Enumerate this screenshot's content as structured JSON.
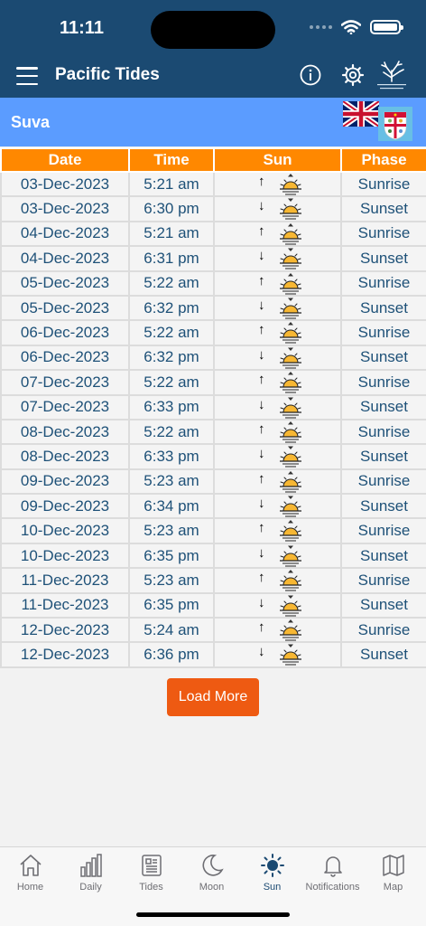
{
  "status": {
    "time": "11:11"
  },
  "header": {
    "title": "Pacific Tides"
  },
  "location": {
    "name": "Suva"
  },
  "table": {
    "columns": [
      "Date",
      "Time",
      "Sun",
      "Phase"
    ],
    "rows": [
      {
        "date": "03-Dec-2023",
        "time": "5:21 am",
        "direction": "up",
        "phase": "Sunrise"
      },
      {
        "date": "03-Dec-2023",
        "time": "6:30 pm",
        "direction": "down",
        "phase": "Sunset"
      },
      {
        "date": "04-Dec-2023",
        "time": "5:21 am",
        "direction": "up",
        "phase": "Sunrise"
      },
      {
        "date": "04-Dec-2023",
        "time": "6:31 pm",
        "direction": "down",
        "phase": "Sunset"
      },
      {
        "date": "05-Dec-2023",
        "time": "5:22 am",
        "direction": "up",
        "phase": "Sunrise"
      },
      {
        "date": "05-Dec-2023",
        "time": "6:32 pm",
        "direction": "down",
        "phase": "Sunset"
      },
      {
        "date": "06-Dec-2023",
        "time": "5:22 am",
        "direction": "up",
        "phase": "Sunrise"
      },
      {
        "date": "06-Dec-2023",
        "time": "6:32 pm",
        "direction": "down",
        "phase": "Sunset"
      },
      {
        "date": "07-Dec-2023",
        "time": "5:22 am",
        "direction": "up",
        "phase": "Sunrise"
      },
      {
        "date": "07-Dec-2023",
        "time": "6:33 pm",
        "direction": "down",
        "phase": "Sunset"
      },
      {
        "date": "08-Dec-2023",
        "time": "5:22 am",
        "direction": "up",
        "phase": "Sunrise"
      },
      {
        "date": "08-Dec-2023",
        "time": "6:33 pm",
        "direction": "down",
        "phase": "Sunset"
      },
      {
        "date": "09-Dec-2023",
        "time": "5:23 am",
        "direction": "up",
        "phase": "Sunrise"
      },
      {
        "date": "09-Dec-2023",
        "time": "6:34 pm",
        "direction": "down",
        "phase": "Sunset"
      },
      {
        "date": "10-Dec-2023",
        "time": "5:23 am",
        "direction": "up",
        "phase": "Sunrise"
      },
      {
        "date": "10-Dec-2023",
        "time": "6:35 pm",
        "direction": "down",
        "phase": "Sunset"
      },
      {
        "date": "11-Dec-2023",
        "time": "5:23 am",
        "direction": "up",
        "phase": "Sunrise"
      },
      {
        "date": "11-Dec-2023",
        "time": "6:35 pm",
        "direction": "down",
        "phase": "Sunset"
      },
      {
        "date": "12-Dec-2023",
        "time": "5:24 am",
        "direction": "up",
        "phase": "Sunrise"
      },
      {
        "date": "12-Dec-2023",
        "time": "6:36 pm",
        "direction": "down",
        "phase": "Sunset"
      }
    ]
  },
  "load_more_label": "Load More",
  "tabs": [
    {
      "label": "Home",
      "icon": "home-icon"
    },
    {
      "label": "Daily",
      "icon": "bar-chart-icon"
    },
    {
      "label": "Tides",
      "icon": "newspaper-icon"
    },
    {
      "label": "Moon",
      "icon": "moon-icon"
    },
    {
      "label": "Sun",
      "icon": "sun-icon",
      "active": true
    },
    {
      "label": "Notifications",
      "icon": "bell-icon"
    },
    {
      "label": "Map",
      "icon": "map-icon"
    }
  ],
  "colors": {
    "header_bg": "#1b4a72",
    "location_bg": "#5b9cff",
    "table_header_bg": "#ff8800",
    "cell_text": "#1e5178",
    "button_bg": "#ee5a12",
    "active_tab": "#1b4a72"
  }
}
